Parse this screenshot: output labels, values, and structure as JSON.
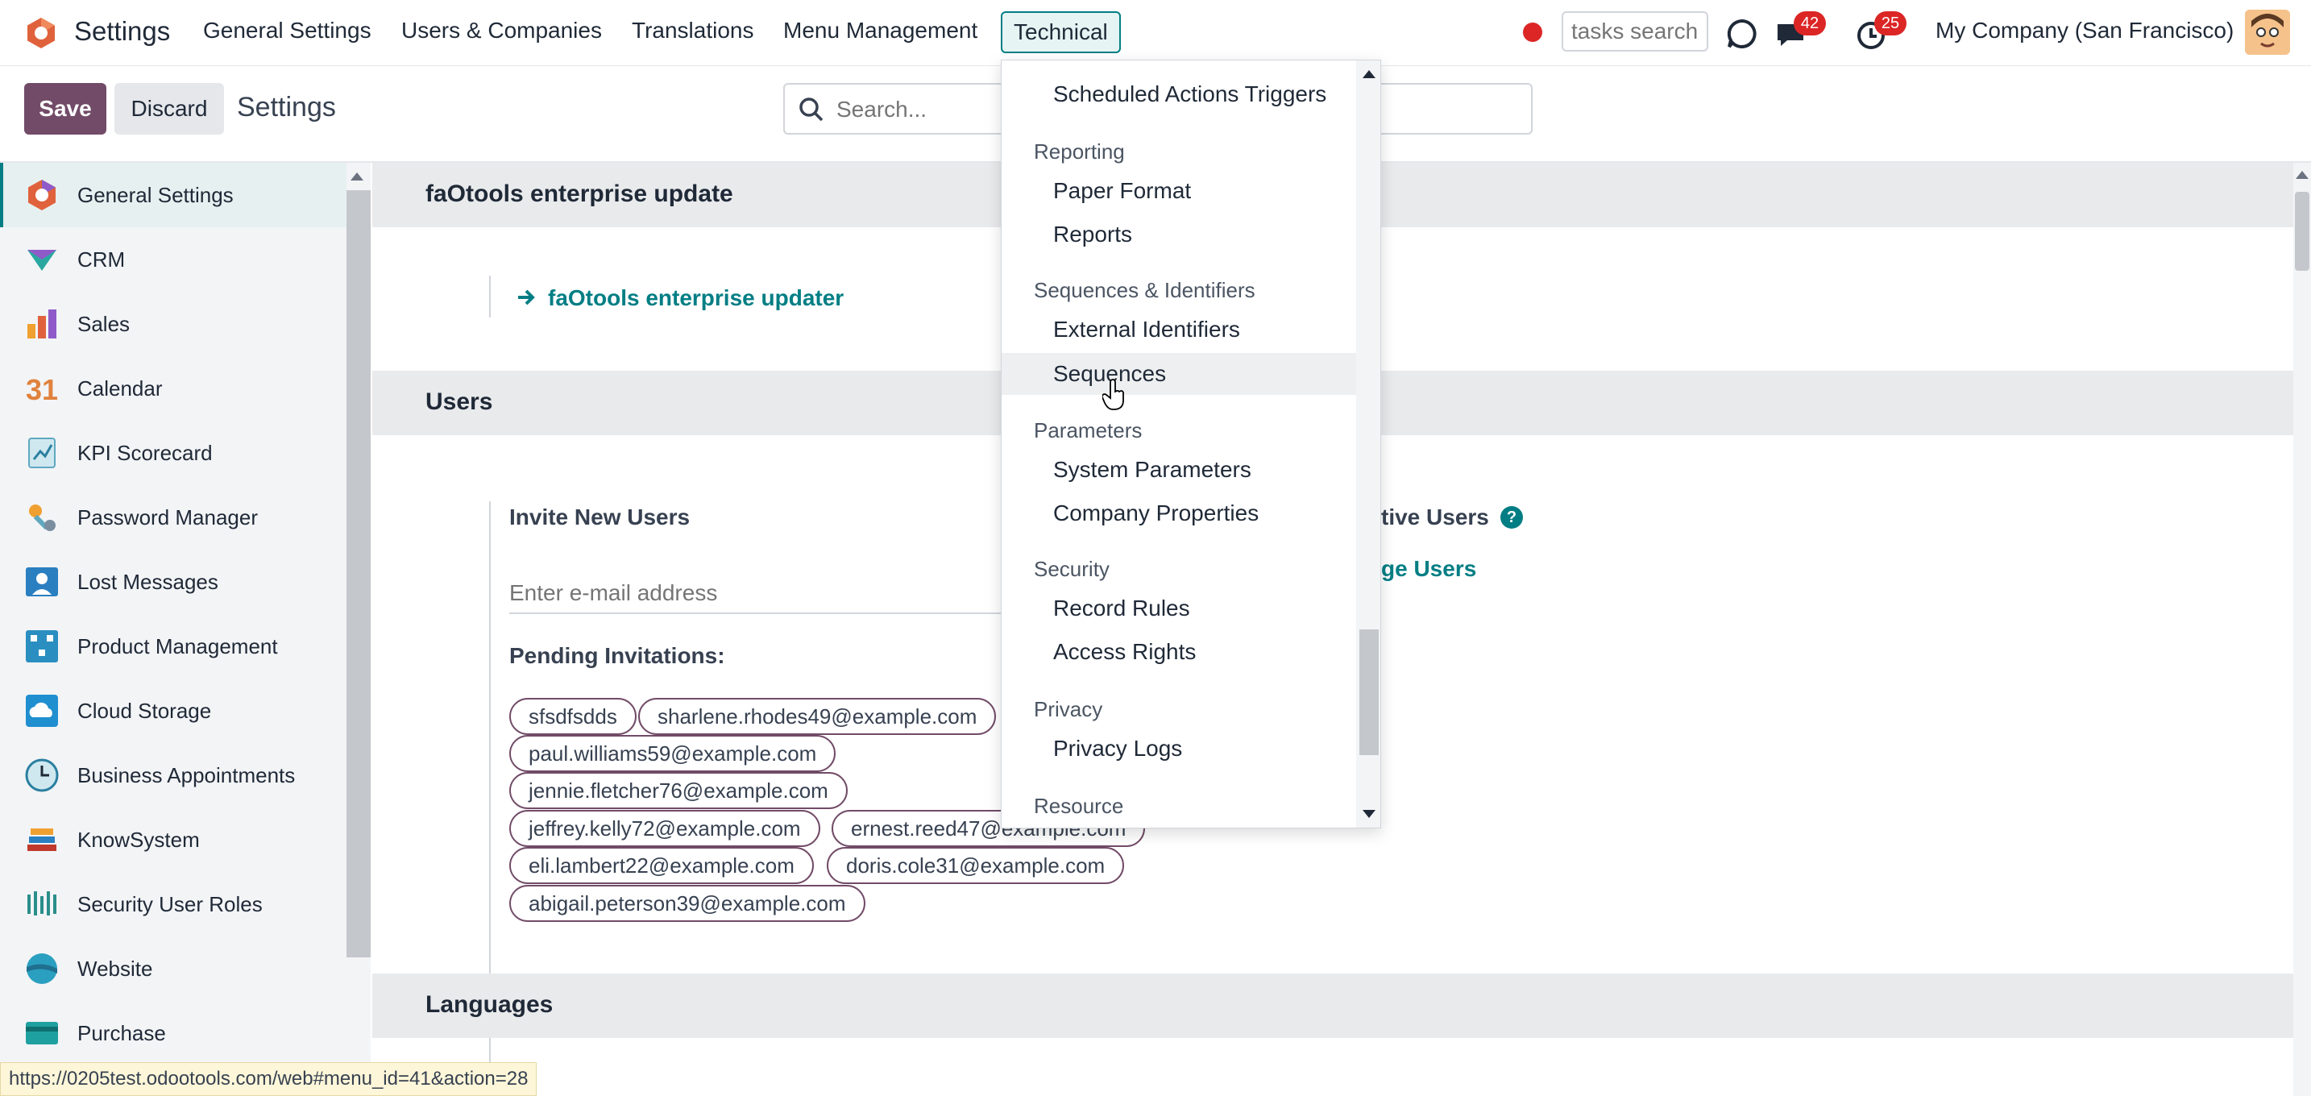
{
  "app": {
    "title": "Settings"
  },
  "topnav": {
    "menus": [
      "General Settings",
      "Users & Companies",
      "Translations",
      "Menu Management",
      "Technical"
    ],
    "tasks_search_placeholder": "tasks search",
    "messages_badge": "42",
    "activities_badge": "25",
    "company": "My Company (San Francisco)"
  },
  "control": {
    "save_label": "Save",
    "discard_label": "Discard",
    "breadcrumb": "Settings",
    "search_placeholder": "Search..."
  },
  "sidebar": {
    "items": [
      {
        "label": "General Settings",
        "icon": "odoo-logo-icon"
      },
      {
        "label": "CRM",
        "icon": "crm-icon"
      },
      {
        "label": "Sales",
        "icon": "sales-chart-icon"
      },
      {
        "label": "Calendar",
        "icon": "calendar-icon"
      },
      {
        "label": "KPI Scorecard",
        "icon": "kpi-scorecard-icon"
      },
      {
        "label": "Password Manager",
        "icon": "password-manager-icon"
      },
      {
        "label": "Lost Messages",
        "icon": "lost-messages-icon"
      },
      {
        "label": "Product Management",
        "icon": "product-management-icon"
      },
      {
        "label": "Cloud Storage",
        "icon": "cloud-storage-icon"
      },
      {
        "label": "Business Appointments",
        "icon": "appointments-clock-icon"
      },
      {
        "label": "KnowSystem",
        "icon": "books-icon"
      },
      {
        "label": "Security User Roles",
        "icon": "security-roles-icon"
      },
      {
        "label": "Website",
        "icon": "website-icon"
      },
      {
        "label": "Purchase",
        "icon": "purchase-icon"
      }
    ]
  },
  "main": {
    "section1_title": "faOtools enterprise update",
    "updater_link": "faOtools enterprise updater",
    "users_title": "Users",
    "invite_label": "Invite New Users",
    "email_placeholder": "Enter e-mail address",
    "pending_label": "Pending Invitations:",
    "active_users_label": "tive Users",
    "manage_users_link": "ge Users",
    "help_glyph": "?",
    "pending_tags": [
      "sfsdfsdds",
      "sharlene.rhodes49@example.com",
      "paul.williams59@example.com",
      "jennie.fletcher76@example.com",
      "jeffrey.kelly72@example.com",
      "ernest.reed47@example.com",
      "eli.lambert22@example.com",
      "doris.cole31@example.com",
      "abigail.peterson39@example.com"
    ],
    "languages_title": "Languages"
  },
  "dropdown": {
    "headers": [
      "Reporting",
      "Sequences & Identifiers",
      "Parameters",
      "Security",
      "Privacy",
      "Resource"
    ],
    "items": [
      "Scheduled Actions Triggers",
      "Paper Format",
      "Reports",
      "External Identifiers",
      "Sequences",
      "System Parameters",
      "Company Properties",
      "Record Rules",
      "Access Rights",
      "Privacy Logs"
    ],
    "hovered": "Sequences"
  },
  "status_url": "https://0205test.odootools.com/web#menu_id=41&action=28",
  "colors": {
    "primary": "#714b67",
    "accent": "#017e84",
    "badge": "#dc2626"
  }
}
